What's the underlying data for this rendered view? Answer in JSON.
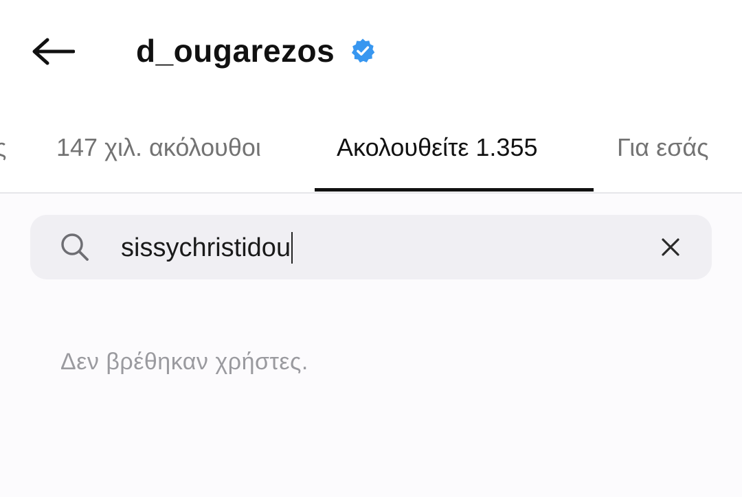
{
  "header": {
    "back_icon": "arrow-left-icon",
    "title": "d_ougarezos",
    "verified_icon": "verified-badge-icon"
  },
  "tabs": [
    {
      "label": "ς",
      "active": false
    },
    {
      "label": "147 χιλ. ακόλουθοι",
      "active": false
    },
    {
      "label": "Ακολουθείτε 1.355",
      "active": true
    },
    {
      "label": "Για εσάς",
      "active": false
    }
  ],
  "search": {
    "icon": "search-icon",
    "value": "sissychristidou",
    "clear_icon": "close-icon"
  },
  "results": {
    "empty_message": "Δεν βρέθηκαν χρήστες."
  },
  "colors": {
    "verified": "#3897f0",
    "text_primary": "#111111",
    "text_secondary": "#737373",
    "search_bg": "#f0eff3"
  }
}
